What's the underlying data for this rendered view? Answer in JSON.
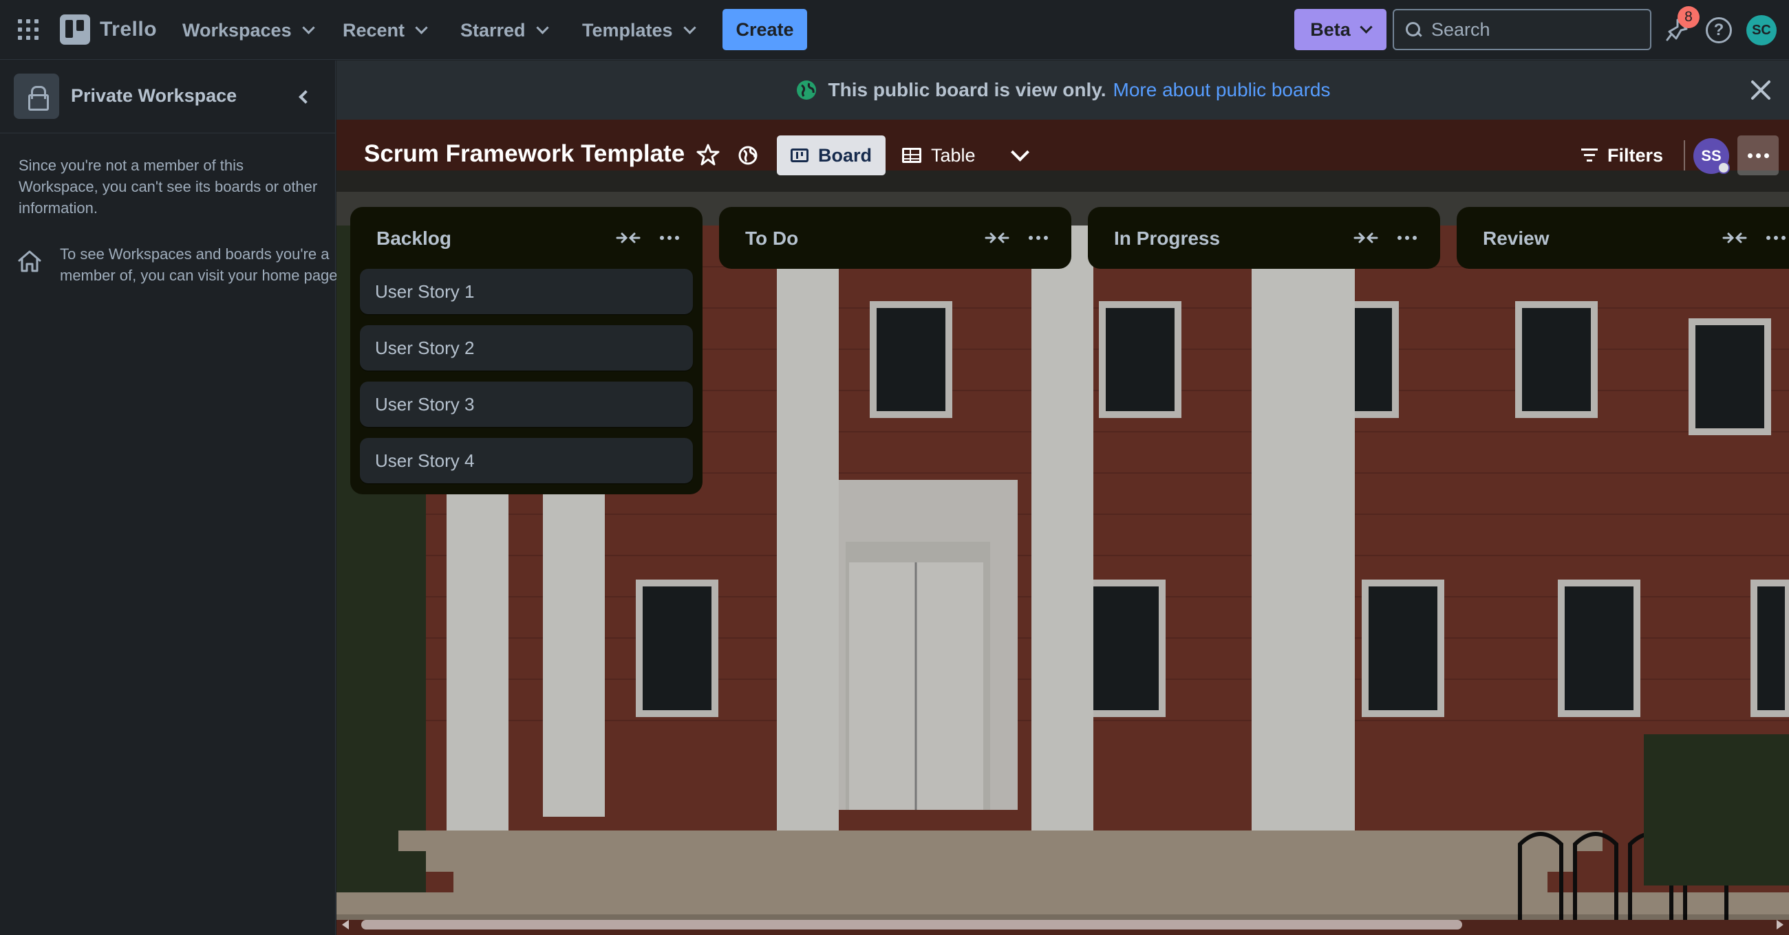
{
  "nav": {
    "logo": "Trello",
    "menus": [
      "Workspaces",
      "Recent",
      "Starred",
      "Templates"
    ],
    "create": "Create",
    "beta": "Beta",
    "search_placeholder": "Search",
    "notification_count": "8",
    "user_initials": "SC"
  },
  "sidebar": {
    "workspace_name": "Private Workspace",
    "note": "Since you're not a member of this Workspace, you can't see its boards or other information.",
    "home_note": "To see Workspaces and boards you're a member of, you can visit your home page."
  },
  "banner": {
    "text": "This public board is view only.",
    "link": "More about public boards"
  },
  "board": {
    "title": "Scrum Framework Template",
    "views": {
      "board": "Board",
      "table": "Table"
    },
    "filters": "Filters",
    "member_initials": "SS"
  },
  "lists": [
    {
      "title": "Backlog",
      "cards": [
        "User Story 1",
        "User Story 2",
        "User Story 3",
        "User Story 4"
      ]
    },
    {
      "title": "To Do",
      "cards": []
    },
    {
      "title": "In Progress",
      "cards": []
    },
    {
      "title": "Review",
      "cards": []
    }
  ],
  "colors": {
    "accent": "#579dff",
    "beta": "#9f8fef",
    "list_bg": "#101204",
    "card_bg": "#22272b",
    "badge": "#f87168"
  }
}
